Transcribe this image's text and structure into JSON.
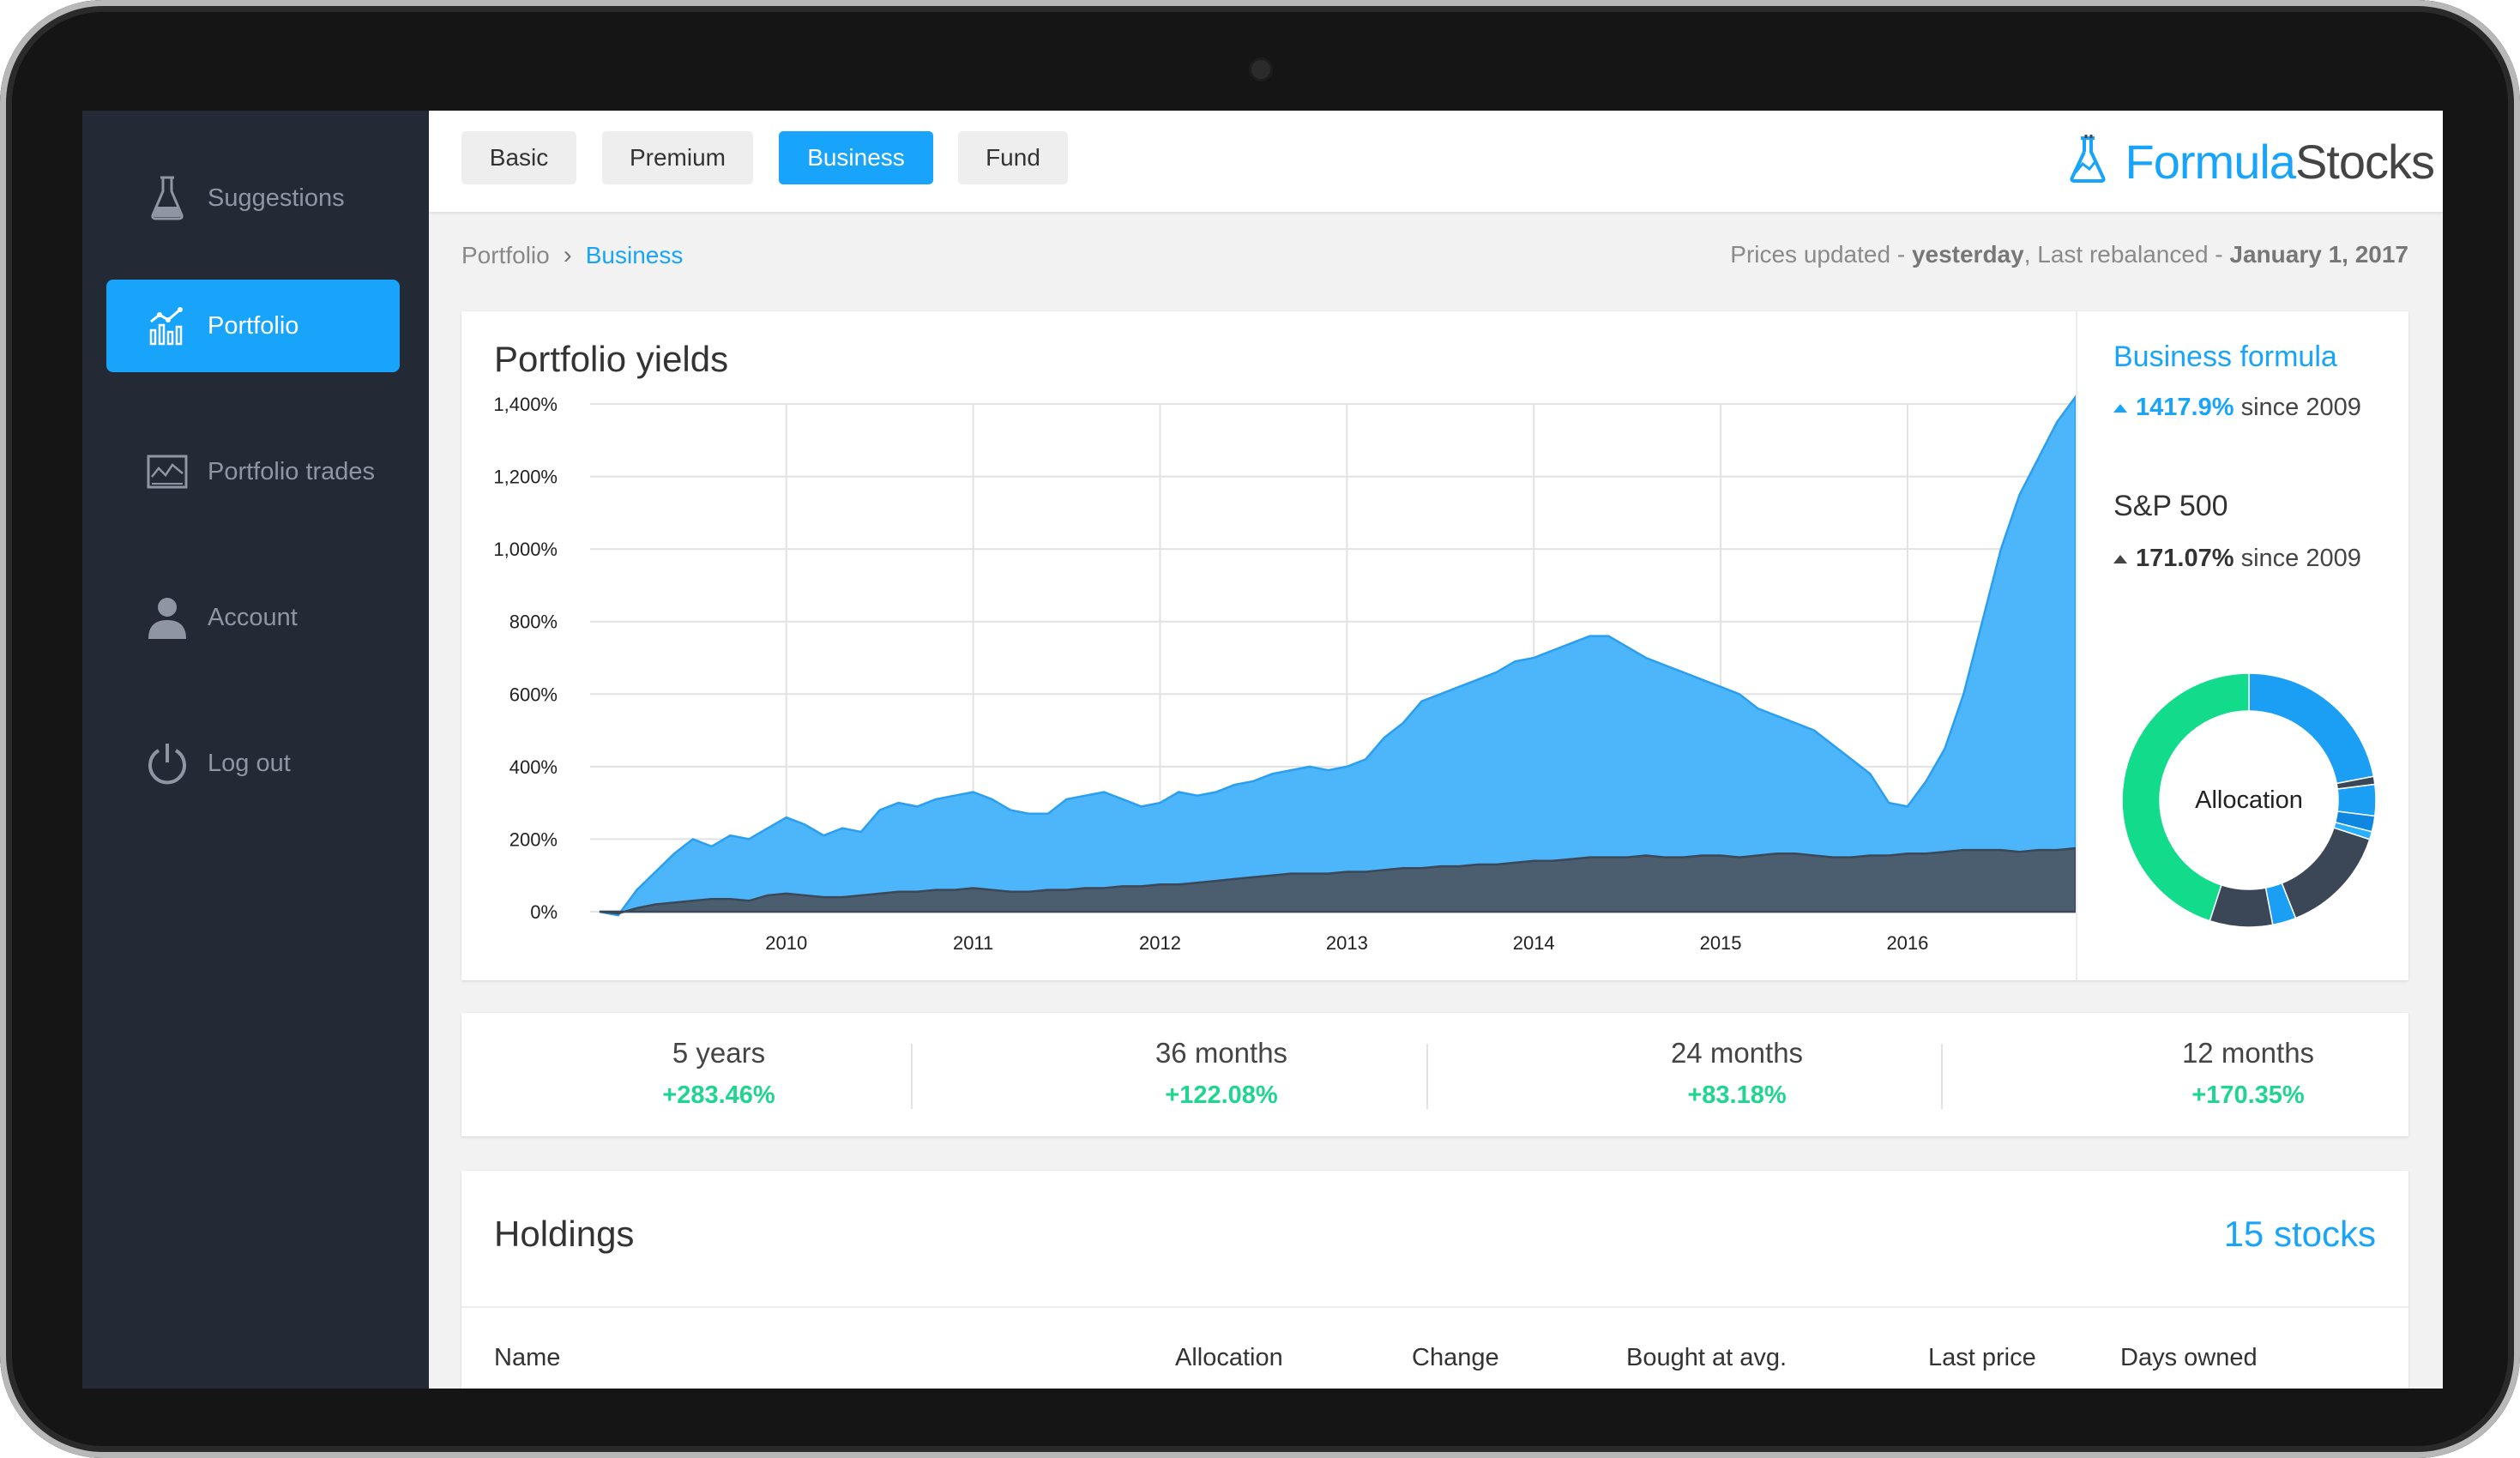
{
  "sidebar": {
    "items": [
      {
        "label": "Suggestions",
        "icon": "flask-icon",
        "active": false
      },
      {
        "label": "Portfolio",
        "icon": "bar-chart-icon",
        "active": true
      },
      {
        "label": "Portfolio trades",
        "icon": "trades-icon",
        "active": false
      },
      {
        "label": "Account",
        "icon": "user-icon",
        "active": false
      },
      {
        "label": "Log out",
        "icon": "power-icon",
        "active": false
      }
    ]
  },
  "header": {
    "tabs": [
      "Basic",
      "Premium",
      "Business",
      "Fund"
    ],
    "active_tab": "Business",
    "logo": {
      "part1": "Formula",
      "part2": "Stocks"
    }
  },
  "breadcrumb": {
    "root": "Portfolio",
    "current": "Business"
  },
  "status": {
    "prices_prefix": "Prices updated - ",
    "prices_value": "yesterday",
    "rebalanced_prefix": ", Last rebalanced - ",
    "rebalanced_value": "January 1, 2017"
  },
  "yields": {
    "title": "Portfolio yields",
    "formula_name": "Business formula",
    "formula_value": "1417.9%",
    "sp_name": "S&P 500",
    "sp_value": "171.07%",
    "since": "since 2009",
    "allocation_label": "Allocation"
  },
  "periods": [
    {
      "label": "5 years",
      "value": "+283.46%"
    },
    {
      "label": "36 months",
      "value": "+122.08%"
    },
    {
      "label": "24 months",
      "value": "+83.18%"
    },
    {
      "label": "12 months",
      "value": "+170.35%"
    }
  ],
  "holdings": {
    "title": "Holdings",
    "count": "15 stocks",
    "columns": [
      "Name",
      "Allocation",
      "Change",
      "Bought at avg.",
      "Last price",
      "Days owned"
    ]
  },
  "colors": {
    "accent": "#18a4fa",
    "area_business": "#4db5f9",
    "area_sp": "#4b5e70",
    "positive": "#1fd58f",
    "sidebar": "#242a35"
  },
  "chart_data": [
    {
      "type": "area",
      "title": "Portfolio yields",
      "x": [
        2009.0,
        2009.1,
        2009.2,
        2009.3,
        2009.4,
        2009.5,
        2009.6,
        2009.7,
        2009.8,
        2009.9,
        2010.0,
        2010.1,
        2010.2,
        2010.3,
        2010.4,
        2010.5,
        2010.6,
        2010.7,
        2010.8,
        2010.9,
        2011.0,
        2011.1,
        2011.2,
        2011.3,
        2011.4,
        2011.5,
        2011.6,
        2011.7,
        2011.8,
        2011.9,
        2012.0,
        2012.1,
        2012.2,
        2012.3,
        2012.4,
        2012.5,
        2012.6,
        2012.7,
        2012.8,
        2012.9,
        2013.0,
        2013.1,
        2013.2,
        2013.3,
        2013.4,
        2013.5,
        2013.6,
        2013.7,
        2013.8,
        2013.9,
        2014.0,
        2014.1,
        2014.2,
        2014.3,
        2014.4,
        2014.5,
        2014.6,
        2014.7,
        2014.8,
        2014.9,
        2015.0,
        2015.1,
        2015.2,
        2015.3,
        2015.4,
        2015.5,
        2015.6,
        2015.7,
        2015.8,
        2015.9,
        2016.0,
        2016.1,
        2016.2,
        2016.3,
        2016.4,
        2016.5,
        2016.6,
        2016.7,
        2016.8,
        2016.9
      ],
      "series": [
        {
          "name": "Business formula",
          "values": [
            0,
            -10,
            60,
            110,
            160,
            200,
            180,
            210,
            200,
            230,
            260,
            240,
            210,
            230,
            220,
            280,
            300,
            290,
            310,
            320,
            330,
            310,
            280,
            270,
            270,
            310,
            320,
            330,
            310,
            290,
            300,
            330,
            320,
            330,
            350,
            360,
            380,
            390,
            400,
            390,
            400,
            420,
            480,
            520,
            580,
            600,
            620,
            640,
            660,
            690,
            700,
            720,
            740,
            760,
            760,
            730,
            700,
            680,
            660,
            640,
            620,
            600,
            560,
            540,
            520,
            500,
            460,
            420,
            380,
            300,
            290,
            360,
            450,
            600,
            800,
            1000,
            1150,
            1250,
            1350,
            1420
          ]
        },
        {
          "name": "S&P 500",
          "values": [
            0,
            -5,
            10,
            20,
            25,
            30,
            35,
            35,
            30,
            45,
            50,
            45,
            40,
            40,
            45,
            50,
            55,
            55,
            60,
            60,
            65,
            60,
            55,
            55,
            60,
            60,
            65,
            65,
            70,
            70,
            75,
            75,
            80,
            85,
            90,
            95,
            100,
            105,
            105,
            105,
            110,
            110,
            115,
            120,
            120,
            125,
            125,
            130,
            130,
            135,
            140,
            140,
            145,
            150,
            150,
            150,
            155,
            150,
            150,
            155,
            155,
            150,
            155,
            160,
            160,
            155,
            150,
            150,
            155,
            155,
            160,
            160,
            165,
            170,
            170,
            170,
            165,
            170,
            170,
            175
          ]
        }
      ],
      "ylim": [
        0,
        1400
      ],
      "yticks": [
        "0%",
        "200%",
        "400%",
        "600%",
        "800%",
        "1,000%",
        "1,200%",
        "1,400%"
      ],
      "xticks": [
        "2010",
        "2011",
        "2012",
        "2013",
        "2014",
        "2015",
        "2016"
      ]
    },
    {
      "type": "pie",
      "title": "Allocation",
      "values": [
        22,
        1,
        4,
        2,
        1,
        14,
        3,
        8,
        45
      ],
      "colors": [
        "#1a9ff5",
        "#3b4757",
        "#1a9ff5",
        "#0f86e0",
        "#2ab0ff",
        "#3b4757",
        "#1a9ff5",
        "#3b4757",
        "#12db8c"
      ]
    }
  ]
}
